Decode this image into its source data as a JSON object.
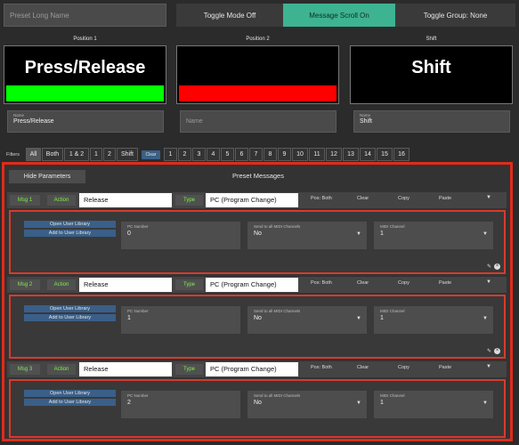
{
  "top_bar": {
    "preset_name_placeholder": "Preset Long Name",
    "toggle_mode": "Toggle Mode Off",
    "message_scroll": "Message Scroll On",
    "toggle_group": "Toggle Group: None"
  },
  "positions": [
    {
      "label": "Position 1",
      "display": "Press/Release",
      "bar_color": "#00ff00",
      "name_label": "Name",
      "name_value": "Press/Release"
    },
    {
      "label": "Position 2",
      "display": "",
      "bar_color": "#ff0000",
      "name_label": "Name",
      "name_value": ""
    },
    {
      "label": "Shift",
      "display": "Shift",
      "bar_color": "",
      "name_label": "Name",
      "name_value": "Shift"
    }
  ],
  "filters": {
    "label": "Filters",
    "buttons": [
      "All",
      "Both",
      "1 & 2",
      "1",
      "2",
      "Shift"
    ],
    "clear": "Clear",
    "numbers": [
      "1",
      "2",
      "3",
      "4",
      "5",
      "6",
      "7",
      "8",
      "9",
      "10",
      "11",
      "12",
      "13",
      "14",
      "15",
      "16"
    ]
  },
  "panel": {
    "hide_parameters": "Hide Parameters",
    "preset_messages": "Preset Messages"
  },
  "messages": [
    {
      "tag": "Msg 1",
      "action_label": "Action",
      "action_value": "Release",
      "type_label": "Type",
      "type_value": "PC (Program Change)",
      "pos": "Pos: Both",
      "clear": "Clear",
      "copy": "Copy",
      "paste": "Paste",
      "open_library": "Open User Library",
      "add_library": "Add to User Library",
      "pc_label": "PC Number",
      "pc_value": "0",
      "send_label": "Send to all MIDI Channels",
      "send_value": "No",
      "channel_label": "MIDI Channel",
      "channel_value": "1"
    },
    {
      "tag": "Msg 2",
      "action_label": "Action",
      "action_value": "Release",
      "type_label": "Type",
      "type_value": "PC (Program Change)",
      "pos": "Pos: Both",
      "clear": "Clear",
      "copy": "Copy",
      "paste": "Paste",
      "open_library": "Open User Library",
      "add_library": "Add to User Library",
      "pc_label": "PC Number",
      "pc_value": "1",
      "send_label": "Send to all MIDI Channels",
      "send_value": "No",
      "channel_label": "MIDI Channel",
      "channel_value": "1"
    },
    {
      "tag": "Msg 3",
      "action_label": "Action",
      "action_value": "Release",
      "type_label": "Type",
      "type_value": "PC (Program Change)",
      "pos": "Pos: Both",
      "clear": "Clear",
      "copy": "Copy",
      "paste": "Paste",
      "open_library": "Open User Library",
      "add_library": "Add to User Library",
      "pc_label": "PC Number",
      "pc_value": "2",
      "send_label": "Send to all MIDI Channels",
      "send_value": "No",
      "channel_label": "MIDI Channel",
      "channel_value": "1"
    }
  ],
  "icons": {
    "edit": "pencil-icon",
    "delete": "close-circle-icon",
    "dropdown": "caret-down-icon"
  },
  "colors": {
    "accent": "#3db391",
    "tag_text": "#7ef04a",
    "highlight_border": "#e02b1a",
    "library_button": "#3a5f88"
  }
}
